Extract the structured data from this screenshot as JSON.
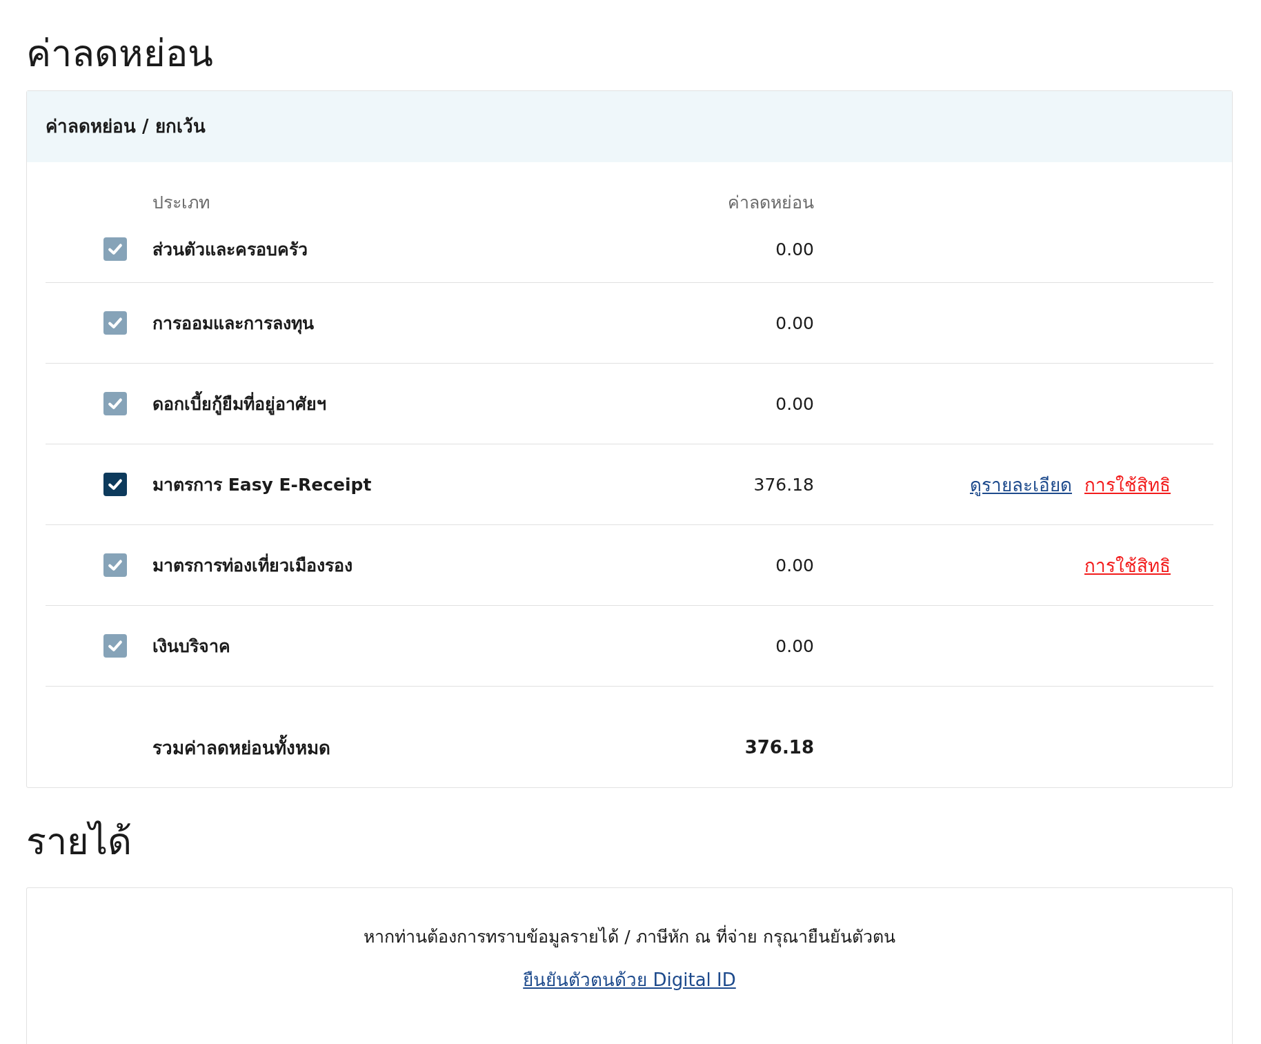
{
  "deductions": {
    "title": "ค่าลดหย่อน",
    "card_header": "ค่าลดหย่อน / ยกเว้น",
    "columns": [
      "ประเภท",
      "ค่าลดหย่อน"
    ],
    "rows": [
      {
        "label": "ส่วนตัวและครอบครัว",
        "checked": true,
        "disabled": true,
        "amount": "0.00"
      },
      {
        "label": "การออมและการลงทุน",
        "checked": true,
        "disabled": true,
        "amount": "0.00"
      },
      {
        "label": "ดอกเบี้ยกู้ยืมที่อยู่อาศัยฯ",
        "checked": true,
        "disabled": true,
        "amount": "0.00"
      },
      {
        "label": "มาตรการ Easy E-Receipt",
        "checked": true,
        "disabled": false,
        "amount": "376.18",
        "links": [
          {
            "kind": "details",
            "text": "ดูรายละเอียด"
          },
          {
            "kind": "claim",
            "text": "การใช้สิทธิ"
          }
        ]
      },
      {
        "label": "มาตรการท่องเที่ยวเมืองรอง",
        "checked": true,
        "disabled": true,
        "amount": "0.00",
        "links": [
          {
            "kind": "claim",
            "text": "การใช้สิทธิ"
          }
        ]
      },
      {
        "label": "เงินบริจาค",
        "checked": true,
        "disabled": true,
        "amount": "0.00"
      }
    ],
    "total": {
      "label": "รวมค่าลดหย่อนทั้งหมด",
      "amount": "376.18"
    }
  },
  "income": {
    "title": "รายได้",
    "message": "หากท่านต้องการทราบข้อมูลรายได้ / ภาษีหัก ณ ที่จ่าย กรุณายืนยันตัวตน",
    "link": "ยืนยันตัวตนด้วย Digital ID"
  }
}
